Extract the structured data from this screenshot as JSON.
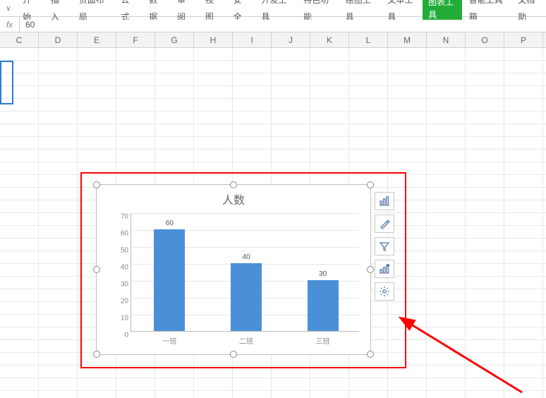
{
  "ribbon": {
    "tabs": [
      "开始",
      "插入",
      "页面布局",
      "公式",
      "数据",
      "审阅",
      "视图",
      "安全",
      "开发工具",
      "特色功能",
      "绘图工具",
      "文本工具",
      "图表工具",
      "智能工具箱",
      "文档助"
    ],
    "active": "图表工具"
  },
  "formula_bar": {
    "fx": "fx",
    "value": "60"
  },
  "columns": [
    "C",
    "D",
    "E",
    "F",
    "G",
    "H",
    "I",
    "J",
    "K",
    "L",
    "M",
    "N",
    "O",
    "P"
  ],
  "chart_data": {
    "type": "bar",
    "title": "人数",
    "categories": [
      "一班",
      "二班",
      "三班"
    ],
    "values": [
      60,
      40,
      30
    ],
    "ylim": [
      0,
      70
    ],
    "ystep": 10,
    "xlabel": "",
    "ylabel": "",
    "bar_color": "#4a90d9"
  },
  "side_tools": [
    "chart-elements-icon",
    "brush-icon",
    "filter-icon",
    "chart-type-icon",
    "gear-icon"
  ]
}
